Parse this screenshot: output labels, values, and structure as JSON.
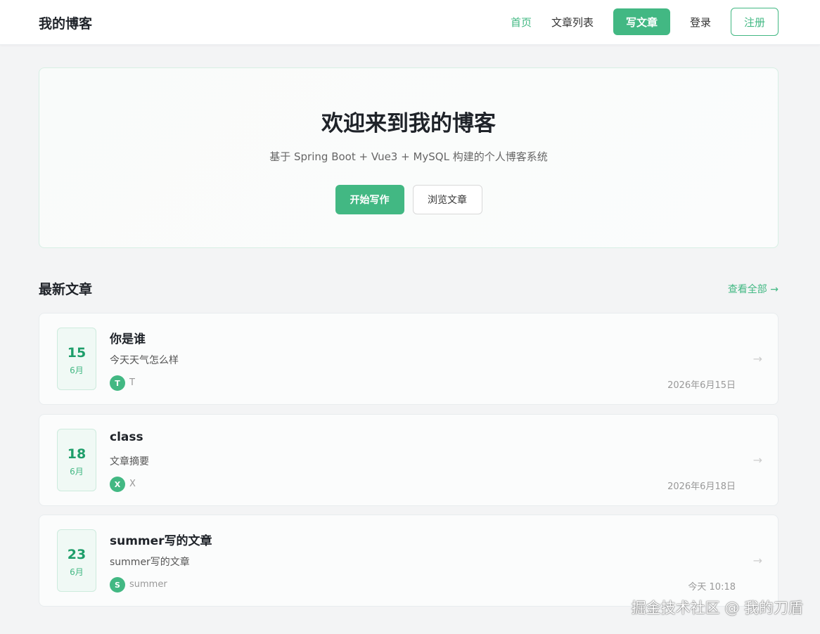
{
  "header": {
    "logo": "我的博客",
    "nav": {
      "home": "首页",
      "articles": "文章列表",
      "write": "写文章",
      "login": "登录",
      "register": "注册"
    }
  },
  "hero": {
    "title": "欢迎来到我的博客",
    "subtitle": "基于 Spring Boot + Vue3 + MySQL 构建的个人博客系统",
    "primary_button": "开始写作",
    "secondary_button": "浏览文章"
  },
  "latest": {
    "title": "最新文章",
    "view_all": "查看全部 →"
  },
  "posts": [
    {
      "day": "15",
      "month": "6月",
      "title": "你是谁",
      "summary": "今天天气怎么样",
      "avatar": "T",
      "author": "T",
      "date": "2026年6月15日",
      "arrow": "→"
    },
    {
      "day": "18",
      "month": "6月",
      "title": "class",
      "summary": "文章摘要",
      "avatar": "X",
      "author": "X",
      "date": "2026年6月18日",
      "arrow": "→"
    },
    {
      "day": "23",
      "month": "6月",
      "title": "summer写的文章",
      "summary": "summer写的文章",
      "avatar": "S",
      "author": "summer",
      "date": "今天 10:18",
      "arrow": "→"
    }
  ],
  "watermark": "掘金技术社区 @ 我的刀盾",
  "colors": {
    "accent": "#42b883",
    "accent_dark": "#1e9e6a",
    "text": "#1f2329",
    "muted": "#999999"
  }
}
